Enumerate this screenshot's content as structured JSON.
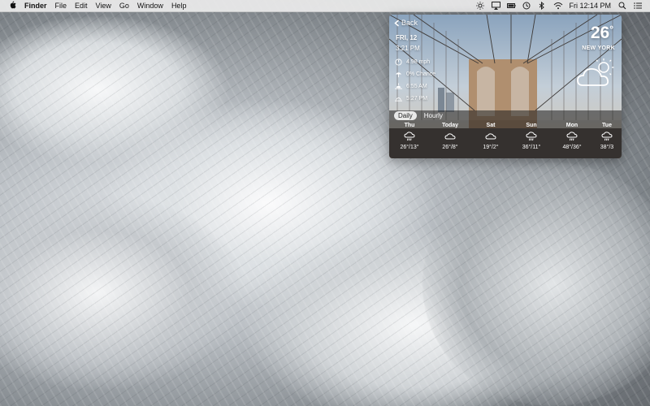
{
  "menubar": {
    "apple": "",
    "app": "Finder",
    "menus": [
      "File",
      "Edit",
      "View",
      "Go",
      "Window",
      "Help"
    ],
    "clock": "Fri 12:14 PM",
    "status_icons": [
      "brightness-icon",
      "airplay-icon",
      "battery-icon",
      "time-machine-icon",
      "bluetooth-icon",
      "wifi-icon",
      "spotlight-icon",
      "notification-center-icon"
    ]
  },
  "weather": {
    "back_label": "Back",
    "date": "FRI, 12",
    "time": "3:21 PM",
    "temperature": "26",
    "degree": "°",
    "city": "NEW YORK",
    "details": [
      {
        "icon": "wind-icon",
        "text": "4.98 mph"
      },
      {
        "icon": "umbrella-icon",
        "text": "0% Chance"
      },
      {
        "icon": "sunrise-icon",
        "text": "6:55 AM"
      },
      {
        "icon": "sunset-icon",
        "text": "5:27 PM"
      }
    ],
    "tabs": [
      "Daily",
      "Hourly"
    ],
    "active_tab": "Daily",
    "forecast": [
      {
        "day": "Thu",
        "range": "26°/13°",
        "icon": "rain-cloud-icon"
      },
      {
        "day": "Today",
        "range": "26°/8°",
        "icon": "cloud-icon"
      },
      {
        "day": "Sat",
        "range": "19°/2°",
        "icon": "cloud-icon"
      },
      {
        "day": "Sun",
        "range": "36°/11°",
        "icon": "rain-cloud-icon"
      },
      {
        "day": "Mon",
        "range": "48°/36°",
        "icon": "rain-cloud-icon"
      },
      {
        "day": "Tue",
        "range": "38°/3",
        "icon": "rain-cloud-icon"
      }
    ]
  }
}
